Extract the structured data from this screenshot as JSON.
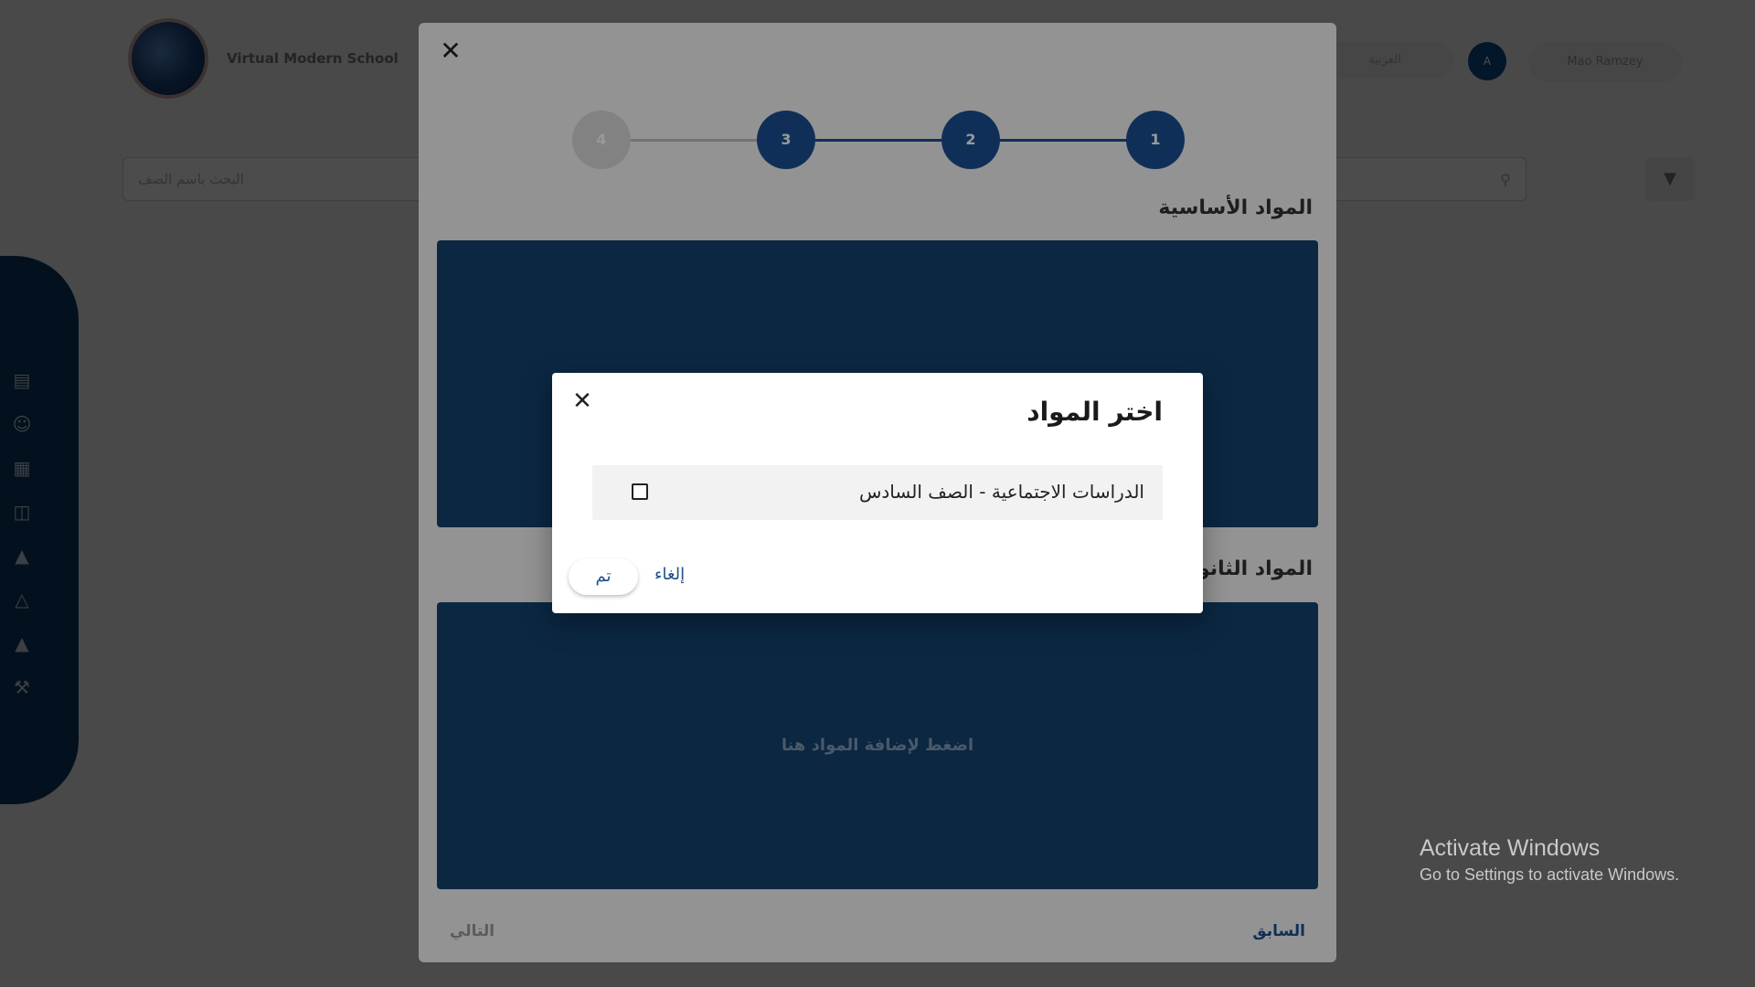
{
  "app": {
    "school_name": "Virtual Modern School",
    "user_name": "Mao Ramzey",
    "avatar_initial": "A",
    "top_field": "العربية",
    "search_placeholder": "البحث باسم الصف",
    "filter_icon": "filter-icon",
    "search_icon": "search-icon"
  },
  "sidebar": {
    "icons": [
      "book-icon",
      "users-icon",
      "calendar-icon",
      "car-icon",
      "megaphone-icon",
      "network-icon",
      "school-icon",
      "tools-icon"
    ]
  },
  "wizard": {
    "steps": [
      "1",
      "2",
      "3",
      "4"
    ],
    "current_step": 3,
    "basic_subjects_title": "المواد الأساسية",
    "secondary_subjects_title": "المواد الثانوية",
    "dropzone_text": "اضغط لإضافة المواد هنا",
    "next_label": "التالي",
    "previous_label": "السابق"
  },
  "dialog": {
    "title": "اختر المواد",
    "options": [
      {
        "label": "الدراسات الاجتماعية - الصف السادس",
        "checked": false
      }
    ],
    "cancel_label": "إلغاء",
    "done_label": "تم"
  },
  "watermark": {
    "title": "Activate Windows",
    "subtitle": "Go to Settings to activate Windows."
  },
  "colors": {
    "primary": "#1b4f93",
    "dropzone": "#13426f",
    "link": "#1f4e8a"
  }
}
